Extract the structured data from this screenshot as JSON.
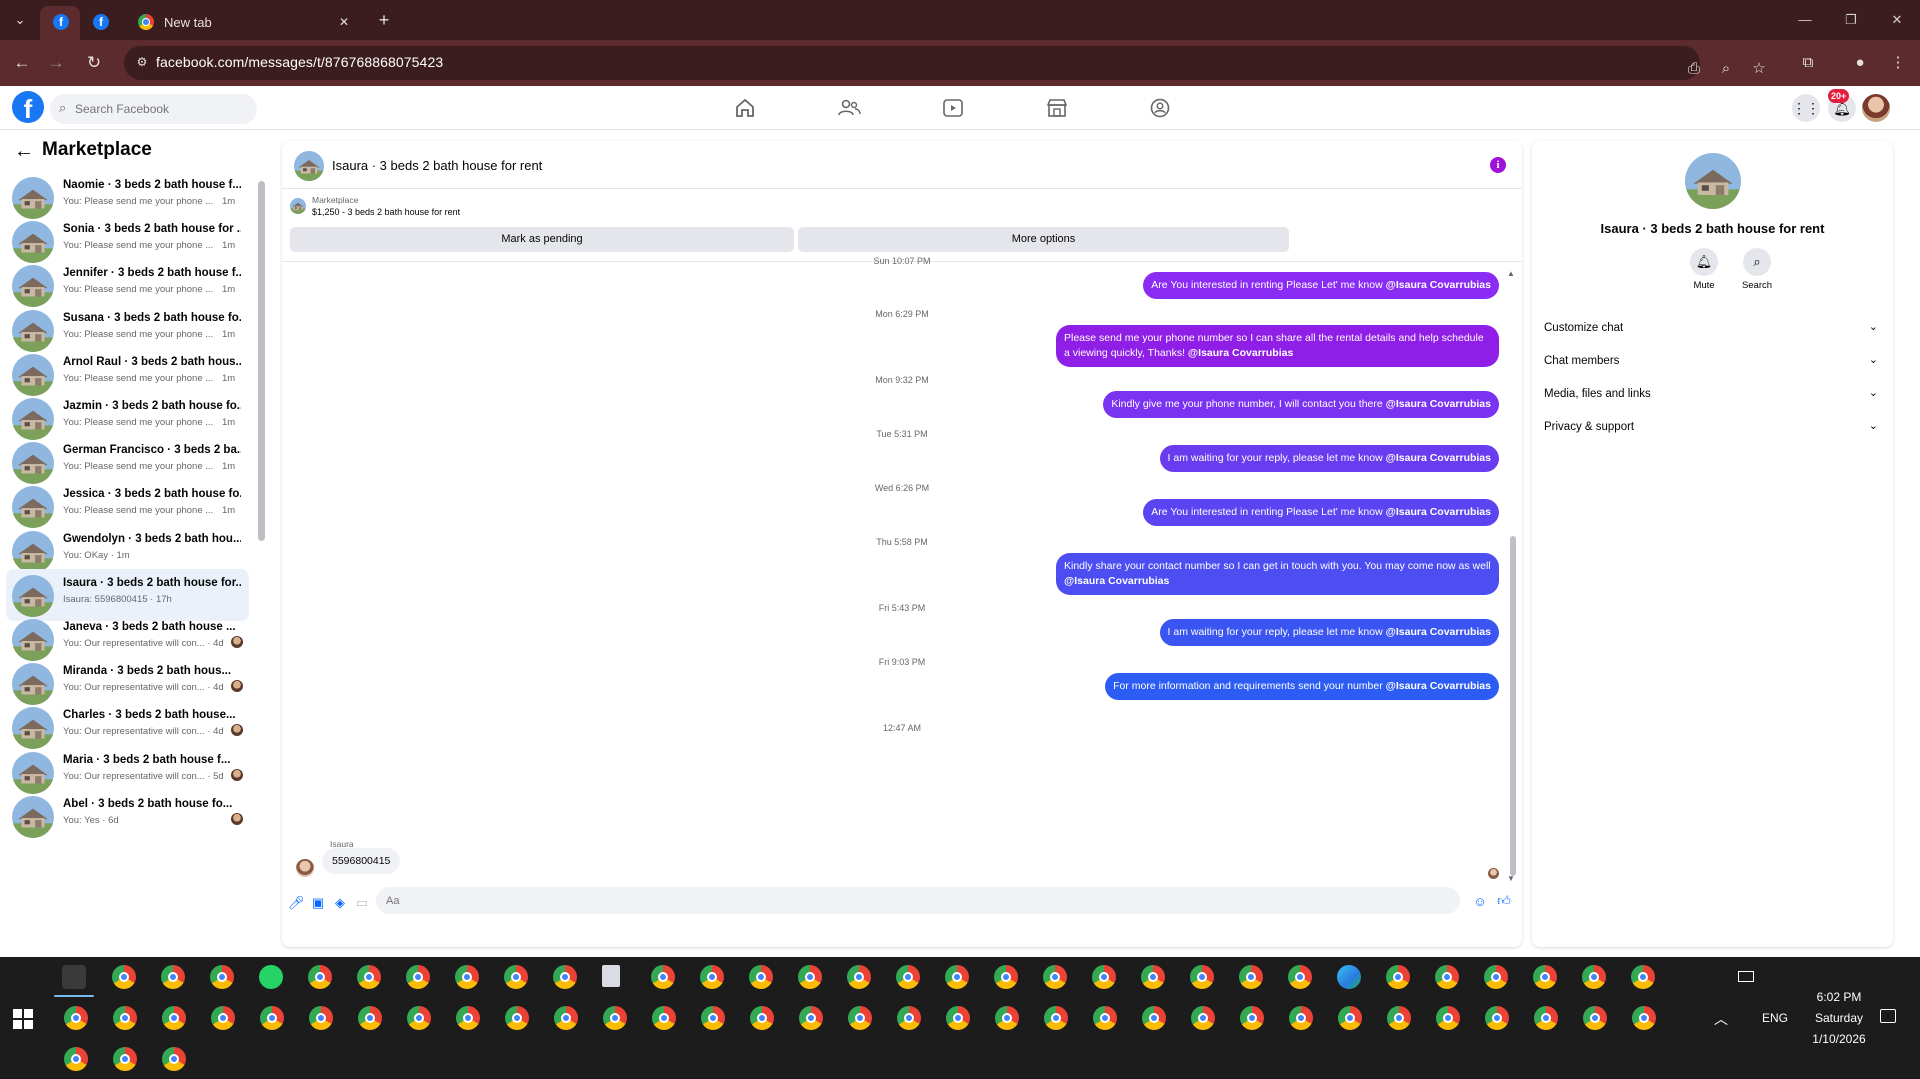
{
  "browser": {
    "tabs": [
      {
        "title": "",
        "favicon": "facebook-icon",
        "pinned": true
      },
      {
        "title": "",
        "favicon": "facebook-icon",
        "pinned": true
      },
      {
        "title": "New tab",
        "favicon": "chrome-icon",
        "pinned": false
      }
    ],
    "url": "facebook.com/messages/t/876768868075423"
  },
  "header": {
    "search_placeholder": "Search Facebook",
    "notifications_badge": "20+"
  },
  "sidebar": {
    "title": "Marketplace",
    "conversations": [
      {
        "name": "Naomie · 3 beds 2 bath house f...",
        "preview": "You: Please send me your phone ...",
        "time": "1m"
      },
      {
        "name": "Sonia · 3 beds 2 bath house for ...",
        "preview": "You: Please send me your phone ...",
        "time": "1m"
      },
      {
        "name": "Jennifer · 3 beds 2 bath house f...",
        "preview": "You: Please send me your phone ...",
        "time": "1m"
      },
      {
        "name": "Susana · 3 beds 2 bath house fo...",
        "preview": "You: Please send me your phone ...",
        "time": "1m"
      },
      {
        "name": "Arnol Raul · 3 beds 2 bath hous...",
        "preview": "You: Please send me your phone ...",
        "time": "1m"
      },
      {
        "name": "Jazmin · 3 beds 2 bath house fo...",
        "preview": "You: Please send me your phone ...",
        "time": "1m"
      },
      {
        "name": "German Francisco · 3 beds 2 ba...",
        "preview": "You: Please send me your phone ...",
        "time": "1m"
      },
      {
        "name": "Jessica · 3 beds 2 bath house fo...",
        "preview": "You: Please send me your phone ...",
        "time": "1m"
      },
      {
        "name": "Gwendolyn · 3 beds 2 bath hou...",
        "preview": "You: OKay · 1m",
        "time": ""
      },
      {
        "name": "Isaura · 3 beds 2 bath house for...",
        "preview": "Isaura: 5596800415 · 17h",
        "time": ""
      },
      {
        "name": "Janeva · 3 beds 2 bath house ...",
        "preview": "You: Our representative will con... · 4d",
        "time": ""
      },
      {
        "name": "Miranda · 3 beds 2 bath hous...",
        "preview": "You: Our representative will con... · 4d",
        "time": ""
      },
      {
        "name": "Charles · 3 beds 2 bath house...",
        "preview": "You: Our representative will con... · 4d",
        "time": ""
      },
      {
        "name": "Maria · 3 beds 2 bath house f...",
        "preview": "You: Our representative will con... · 5d",
        "time": ""
      },
      {
        "name": "Abel · 3 beds 2 bath house fo...",
        "preview": "You: Yes · 6d",
        "time": ""
      }
    ]
  },
  "chat": {
    "title": "Isaura · 3 beds 2 bath house for rent",
    "listing_source": "Marketplace",
    "listing_price_title": "$1,250 - 3 beds 2 bath house for rent",
    "mark_pending_label": "Mark as pending",
    "more_options_label": "More options",
    "messages": [
      {
        "ts": "Sun 10:07 PM",
        "text": "Are You  interested in renting Please Let' me know ",
        "mention": "@Isaura Covarrubias",
        "color": "#8a2cf3"
      },
      {
        "ts": "Mon 6:29 PM",
        "text": "Please send me your phone number so I can share all the rental details and help schedule a viewing quickly, Thanks! ",
        "mention": "@Isaura Covarrubias",
        "color": "#8f1ee6"
      },
      {
        "ts": "Mon 9:32 PM",
        "text": "Kindly give me your phone number, I will contact you there ",
        "mention": "@Isaura Covarrubias",
        "color": "#7a33f0"
      },
      {
        "ts": "Tue 5:31 PM",
        "text": "I am waiting for your reply, please let me know ",
        "mention": "@Isaura Covarrubias",
        "color": "#6a3cf0"
      },
      {
        "ts": "Wed 6:26 PM",
        "text": "Are You  interested in renting Please Let' me know ",
        "mention": "@Isaura Covarrubias",
        "color": "#5b44f1"
      },
      {
        "ts": "Thu 5:58 PM",
        "text": "Kindly share your contact number so I can get in touch with you. You may come now as well ",
        "mention": "@Isaura Covarrubias",
        "color": "#4d4ef2"
      },
      {
        "ts": "Fri 5:43 PM",
        "text": "I am waiting for your reply, please let me know ",
        "mention": "@Isaura Covarrubias",
        "color": "#3a55f2"
      },
      {
        "ts": "Fri 9:03 PM",
        "text": "For more information and requirements send your number ",
        "mention": "@Isaura Covarrubias",
        "color": "#2c5cf3"
      }
    ],
    "last_ts": "12:47 AM",
    "incoming_name": "Isaura",
    "incoming_text": "5596800415",
    "input_placeholder": "Aa"
  },
  "info_panel": {
    "title": "Isaura · 3 beds 2 bath house for rent",
    "mute_label": "Mute",
    "search_label": "Search",
    "rows": [
      "Customize chat",
      "Chat members",
      "Media, files and links",
      "Privacy & support"
    ]
  },
  "taskbar": {
    "time": "6:02 PM",
    "day": "Saturday",
    "date": "1/10/2026",
    "lang": "ENG"
  }
}
